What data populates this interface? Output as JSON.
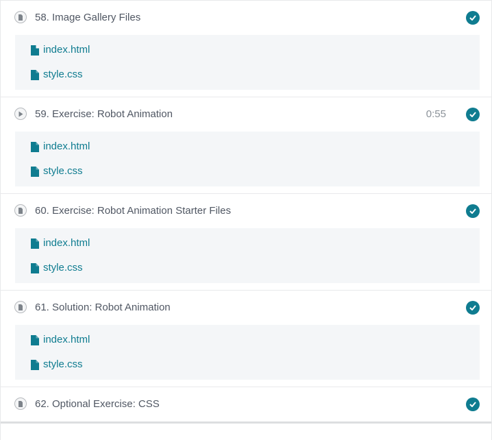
{
  "lectures": [
    {
      "number_title": "58. Image Gallery Files",
      "type_icon": "file-icon",
      "duration": "",
      "completed": true,
      "resources": [
        {
          "label": "index.html",
          "icon": "file-icon"
        },
        {
          "label": "style.css",
          "icon": "file-icon"
        }
      ]
    },
    {
      "number_title": "59. Exercise: Robot Animation",
      "type_icon": "play-icon",
      "duration": "0:55",
      "completed": true,
      "resources": [
        {
          "label": "index.html",
          "icon": "file-icon"
        },
        {
          "label": "style.css",
          "icon": "file-icon"
        }
      ]
    },
    {
      "number_title": "60. Exercise: Robot Animation Starter Files",
      "type_icon": "file-icon",
      "duration": "",
      "completed": true,
      "resources": [
        {
          "label": "index.html",
          "icon": "file-icon"
        },
        {
          "label": "style.css",
          "icon": "file-icon"
        }
      ]
    },
    {
      "number_title": "61. Solution: Robot Animation",
      "type_icon": "file-icon",
      "duration": "",
      "completed": true,
      "resources": [
        {
          "label": "index.html",
          "icon": "file-icon"
        },
        {
          "label": "style.css",
          "icon": "file-icon"
        }
      ]
    },
    {
      "number_title": "62. Optional Exercise: CSS",
      "type_icon": "file-icon",
      "duration": "",
      "completed": true,
      "resources": []
    }
  ],
  "colors": {
    "accent": "#0f7c90",
    "text": "#505763",
    "muted": "#8b9299",
    "resource_bg": "#f4f6f8"
  }
}
